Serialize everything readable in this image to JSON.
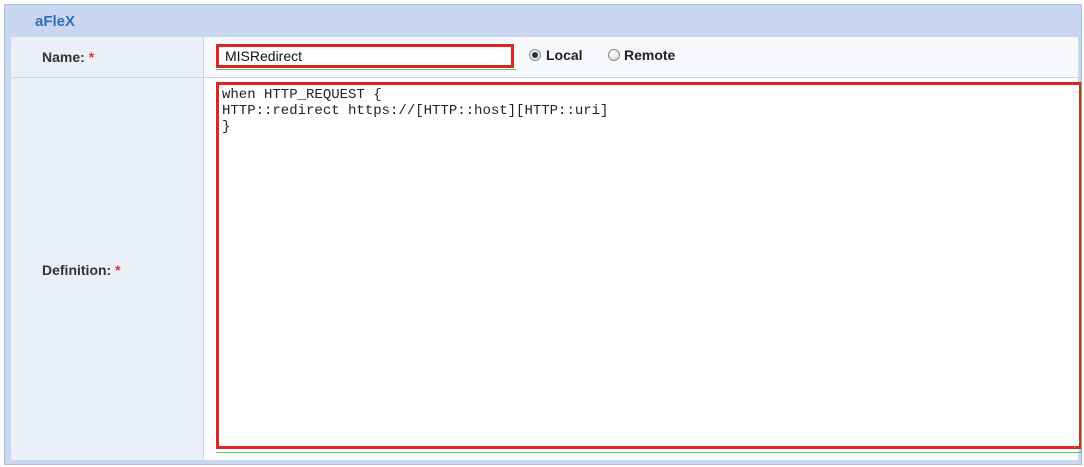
{
  "panel": {
    "title": "aFleX"
  },
  "form": {
    "name": {
      "label": "Name:",
      "required_mark": "*",
      "value": "MISRedirect"
    },
    "location": {
      "options": [
        {
          "label": "Local",
          "checked": true
        },
        {
          "label": "Remote",
          "checked": false
        }
      ]
    },
    "definition": {
      "label": "Definition:",
      "required_mark": "*",
      "value": "when HTTP_REQUEST {\nHTTP::redirect https://[HTTP::host][HTTP::uri]\n}"
    }
  },
  "colors": {
    "panel_bg": "#c9d8f0",
    "title": "#2e6fb3",
    "required": "#e03030",
    "highlight_border": "#e02424",
    "field_underline": "#59c959"
  }
}
